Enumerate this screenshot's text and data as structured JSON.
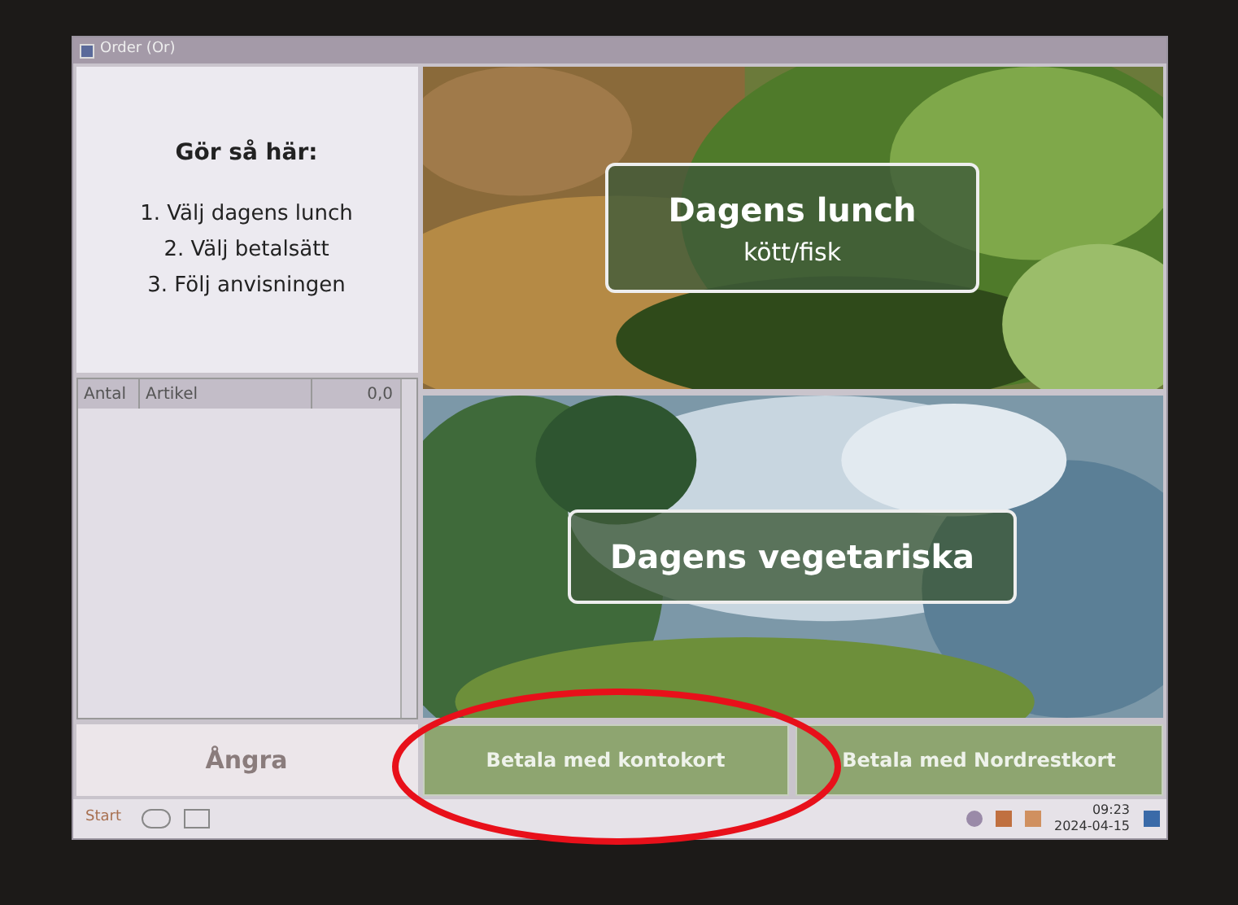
{
  "window": {
    "title": "Order (Or)"
  },
  "instructions": {
    "heading": "Gör så här:",
    "steps": [
      "1. Välj dagens lunch",
      "2. Välj betalsätt",
      "3. Följ anvisningen"
    ]
  },
  "order_table": {
    "columns": [
      "Antal",
      "Artikel"
    ],
    "total": "0,0"
  },
  "menu_buttons": [
    {
      "title": "Dagens lunch",
      "subtitle": "kött/fisk"
    },
    {
      "title": "Dagens vegetariska"
    }
  ],
  "undo_button": "Ångra",
  "pay_buttons": [
    "Betala med kontokort",
    "Betala med Nordrestkort"
  ],
  "taskbar": {
    "start": "Start",
    "time": "09:23",
    "date": "2024-04-15"
  }
}
